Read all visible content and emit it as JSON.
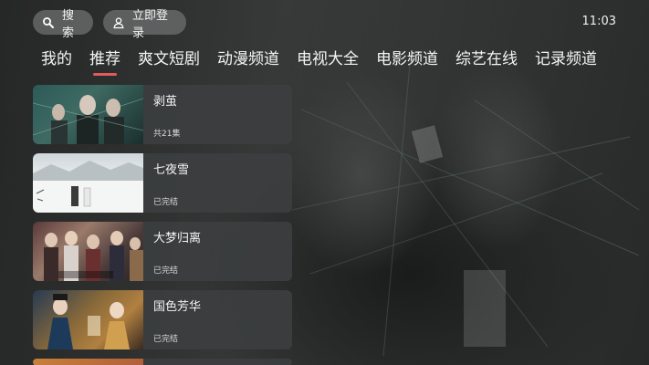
{
  "topbar": {
    "search_label": "搜索",
    "login_label": "立即登录",
    "time": "11:03"
  },
  "tabs": [
    {
      "label": "我的",
      "active": false
    },
    {
      "label": "推荐",
      "active": true
    },
    {
      "label": "爽文短剧",
      "active": false
    },
    {
      "label": "动漫频道",
      "active": false
    },
    {
      "label": "电视大全",
      "active": false
    },
    {
      "label": "电影频道",
      "active": false
    },
    {
      "label": "综艺在线",
      "active": false
    },
    {
      "label": "记录频道",
      "active": false
    }
  ],
  "list": [
    {
      "title": "剥茧",
      "sub": "共21集",
      "thumb_icon": "poster-bojian"
    },
    {
      "title": "七夜雪",
      "sub": "已完结",
      "thumb_icon": "poster-qiyexue"
    },
    {
      "title": "大梦归离",
      "sub": "已完结",
      "thumb_icon": "poster-dameng"
    },
    {
      "title": "国色芳华",
      "sub": "已完结",
      "thumb_icon": "poster-guose"
    }
  ],
  "colors": {
    "accent": "#e05a5e",
    "pill_bg": "#6e7070",
    "card_bg": "#3c3e3f"
  }
}
